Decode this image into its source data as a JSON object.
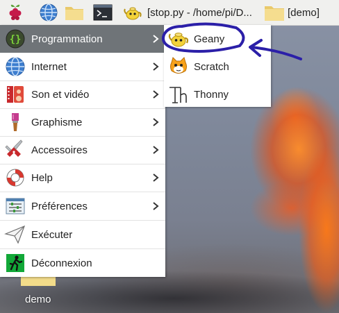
{
  "taskbar": {
    "windows": [
      {
        "label": "[stop.py - /home/pi/D..."
      },
      {
        "label": "[demo]"
      }
    ]
  },
  "menu": {
    "items": [
      {
        "label": "Programmation",
        "icon": "code-braces-icon",
        "submenu": true
      },
      {
        "label": "Internet",
        "icon": "globe-icon",
        "submenu": true
      },
      {
        "label": "Son et vidéo",
        "icon": "film-speaker-icon",
        "submenu": true
      },
      {
        "label": "Graphisme",
        "icon": "paintbrush-icon",
        "submenu": true
      },
      {
        "label": "Accessoires",
        "icon": "pocket-knife-icon",
        "submenu": true
      },
      {
        "label": "Help",
        "icon": "lifebuoy-icon",
        "submenu": true
      },
      {
        "label": "Préférences",
        "icon": "preferences-icon",
        "submenu": true
      },
      {
        "label": "Exécuter",
        "icon": "paper-plane-icon",
        "submenu": false
      },
      {
        "label": "Déconnexion",
        "icon": "exit-icon",
        "submenu": false
      }
    ]
  },
  "submenu": {
    "items": [
      {
        "label": "Geany",
        "icon": "geany-teapot-icon"
      },
      {
        "label": "Scratch",
        "icon": "scratch-cat-icon"
      },
      {
        "label": "Thonny",
        "icon": "thonny-icon"
      }
    ]
  },
  "desktop": {
    "folder_label": "demo"
  },
  "colors": {
    "menu_active_bg": "#6f7478",
    "annotation": "#2b1fa8",
    "taskbar_bg": "#f0f0ee"
  }
}
